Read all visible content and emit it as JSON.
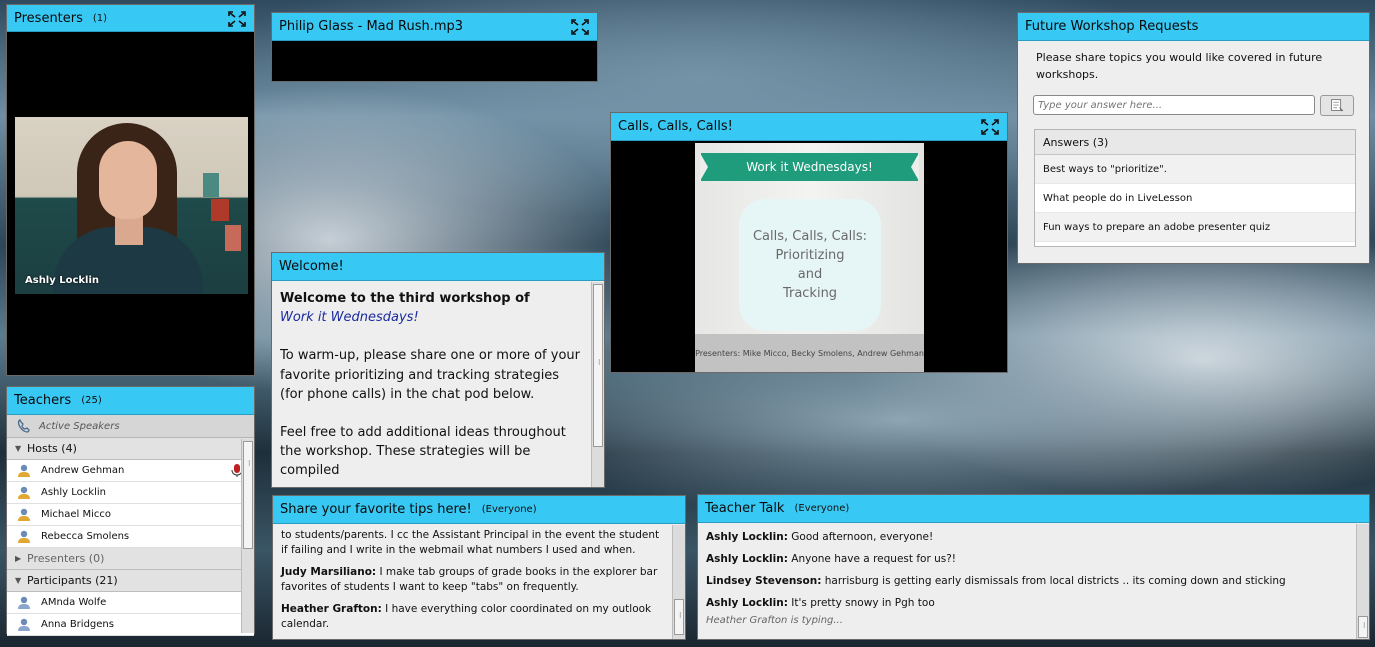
{
  "presenters": {
    "title": "Presenters",
    "count": "(1)",
    "video_name": "Ashly Locklin"
  },
  "teachers": {
    "title": "Teachers",
    "count": "(25)",
    "active_speakers": "Active Speakers",
    "hosts_label": "Hosts (4)",
    "hosts": [
      {
        "name": "Andrew Gehman"
      },
      {
        "name": "Ashly Locklin"
      },
      {
        "name": "Michael Micco"
      },
      {
        "name": "Rebecca Smolens"
      }
    ],
    "presenters_label": "Presenters (0)",
    "participants_label": "Participants (21)",
    "participants": [
      {
        "name": "AMnda Wolfe"
      },
      {
        "name": "Anna Bridgens"
      }
    ]
  },
  "music": {
    "title": "Philip Glass - Mad Rush.mp3"
  },
  "welcome": {
    "title": "Welcome!",
    "line1": "Welcome to the third workshop of",
    "line2": "Work it Wednesdays!",
    "para1": "To warm-up, please share one or more of your favorite prioritizing and tracking strategies (for phone calls) in the chat pod below.",
    "para2": "Feel free to add additional ideas throughout the workshop. These strategies will be compiled"
  },
  "calls": {
    "title": "Calls, Calls, Calls!",
    "slide_banner": "Work it Wednesdays!",
    "slide_badge_l1": "Calls, Calls, Calls:",
    "slide_badge_l2": "Prioritizing",
    "slide_badge_l3": "and",
    "slide_badge_l4": "Tracking",
    "slide_footer": "Presenters: Mike Micco, Becky Smolens, Andrew Gehman"
  },
  "future": {
    "title": "Future Workshop Requests",
    "prompt": "Please share topics you would like covered in future workshops.",
    "input_placeholder": "Type your answer here...",
    "answers_label": "Answers (3)",
    "answers": [
      {
        "text": "Best ways to \"prioritize\"."
      },
      {
        "text": "What people do in LiveLesson"
      },
      {
        "text": "Fun ways to prepare an adobe presenter quiz"
      }
    ]
  },
  "tips": {
    "title": "Share your favorite tips here!",
    "scope": "(Everyone)",
    "messages": [
      {
        "who": "",
        "text": "to students/parents. I cc the Assistant Principal in the event the student if failing and I write in the webmail what numbers I used and when."
      },
      {
        "who": "Judy Marsiliano:",
        "text": "I make tab groups of grade books in the explorer bar favorites of students I want to keep \"tabs\" on frequently."
      },
      {
        "who": "Heather Grafton:",
        "text": "I have everything color coordinated on my outlook calendar."
      }
    ]
  },
  "talk": {
    "title": "Teacher Talk",
    "scope": "(Everyone)",
    "messages": [
      {
        "who": "Ashly Locklin:",
        "text": "Good afternoon, everyone!"
      },
      {
        "who": "Ashly Locklin:",
        "text": "Anyone have a request for us?!"
      },
      {
        "who": "Lindsey Stevenson:",
        "text": "harrisburg is getting early dismissals from local districts .. its coming down and sticking"
      },
      {
        "who": "Ashly Locklin:",
        "text": "It's pretty snowy in Pgh too"
      }
    ],
    "typing": "Heather Grafton is typing..."
  }
}
